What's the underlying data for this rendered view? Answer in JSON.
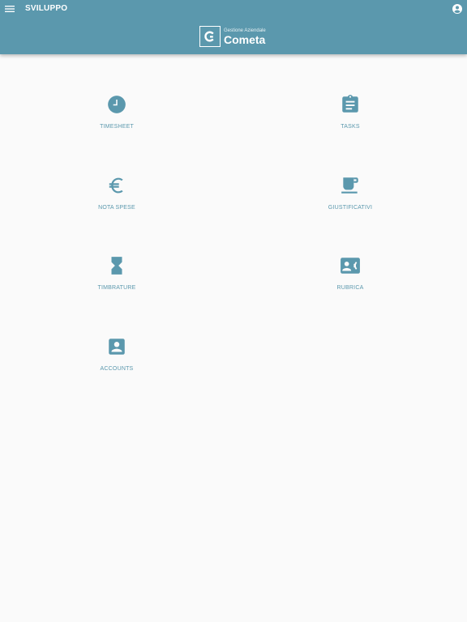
{
  "appbar": {
    "title": "SVILUPPO",
    "menu_icon": "menu-icon",
    "account_icon": "account-circle-icon",
    "color": "#5b98ad"
  },
  "brand": {
    "subtitle": "Gestione Aziendale",
    "name": "Cometa",
    "logo_icon": "cometa-logo-icon"
  },
  "tiles": [
    {
      "label": "TIMESHEET",
      "icon": "clock-icon"
    },
    {
      "label": "TASKS",
      "icon": "clipboard-icon"
    },
    {
      "label": "NOTA SPESE",
      "icon": "euro-icon"
    },
    {
      "label": "GIUSTIFICATIVI",
      "icon": "coffee-cup-icon"
    },
    {
      "label": "TIMBRATURE",
      "icon": "hourglass-icon"
    },
    {
      "label": "RUBRICA",
      "icon": "contact-phone-icon"
    },
    {
      "label": "ACCOUNTS",
      "icon": "account-box-icon"
    }
  ],
  "colors": {
    "accent": "#5b98ad",
    "background": "#fafafa"
  }
}
